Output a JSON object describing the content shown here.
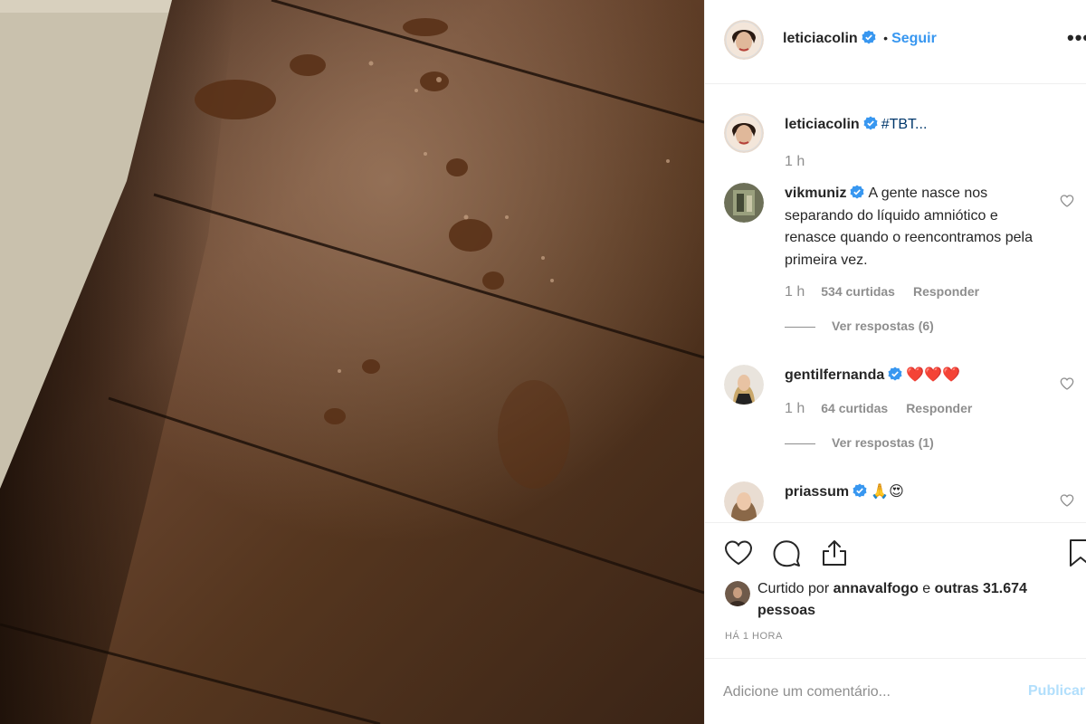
{
  "post": {
    "author": "leticiacolin",
    "separator": "•",
    "follow_label": "Seguir",
    "more_label": "•••"
  },
  "caption": {
    "username": "leticiacolin",
    "text": "#TBT...",
    "time": "1 h"
  },
  "comments": [
    {
      "username": "vikmuniz",
      "text": "A gente nasce nos separando do líquido amniótico e renasce quando o reencontramos pela primeira vez.",
      "time": "1 h",
      "likes": "534 curtidas",
      "reply_label": "Responder",
      "view_replies": "Ver respostas (6)"
    },
    {
      "username": "gentilfernanda",
      "text": "❤️❤️❤️",
      "time": "1 h",
      "likes": "64 curtidas",
      "reply_label": "Responder",
      "view_replies": "Ver respostas (1)"
    },
    {
      "username": "priassum",
      "text": "🙏😍"
    }
  ],
  "likes": {
    "prefix": "Curtido por",
    "liker": "annavalfogo",
    "conjunction": "e",
    "others": "outras 31.674 pessoas"
  },
  "timestamp": "HÁ 1 HORA",
  "add_comment": {
    "placeholder": "Adicione um comentário...",
    "publish_label": "Publicar"
  },
  "colors": {
    "accent": "#3897f0",
    "publish_disabled": "#b2dffc",
    "muted": "#8e8e8e"
  }
}
